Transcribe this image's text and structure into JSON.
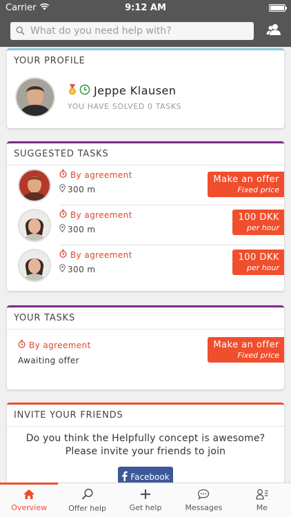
{
  "status_bar": {
    "carrier": "Carrier",
    "time": "9:12 AM"
  },
  "search": {
    "placeholder": "What do you need help with?"
  },
  "profile": {
    "heading": "YOUR PROFILE",
    "name": "Jeppe Klausen",
    "solved_text": "YOU HAVE SOLVED 0 TASKS"
  },
  "suggested": {
    "heading": "SUGGESTED TASKS",
    "tasks": [
      {
        "time": "By agreement",
        "distance": "300 m",
        "price": "Make an offer",
        "price_type": "Fixed price"
      },
      {
        "time": "By agreement",
        "distance": "300 m",
        "price": "100 DKK",
        "price_type": "per hour"
      },
      {
        "time": "By agreement",
        "distance": "300 m",
        "price": "100 DKK",
        "price_type": "per hour"
      }
    ]
  },
  "your_tasks": {
    "heading": "YOUR TASKS",
    "task": {
      "time": "By agreement",
      "status": "Awaiting offer",
      "price": "Make an offer",
      "price_type": "Fixed price"
    }
  },
  "invite": {
    "heading": "INVITE YOUR FRIENDS",
    "line1": "Do you think the Helpfully concept is awesome?",
    "line2": "Please invite your friends to join",
    "facebook_label": "Facebook"
  },
  "tabs": [
    {
      "label": "Overview",
      "icon": "home-icon",
      "active": true
    },
    {
      "label": "Offer help",
      "icon": "search-icon",
      "active": false
    },
    {
      "label": "Get help",
      "icon": "plus-icon",
      "active": false
    },
    {
      "label": "Messages",
      "icon": "chat-icon",
      "active": false
    },
    {
      "label": "Me",
      "icon": "profile-icon",
      "active": false
    }
  ],
  "colors": {
    "accent": "#f04e2d",
    "purple": "#7b2a86",
    "header": "#565656",
    "profile_border": "#8cc6dc",
    "facebook": "#3b5998"
  }
}
